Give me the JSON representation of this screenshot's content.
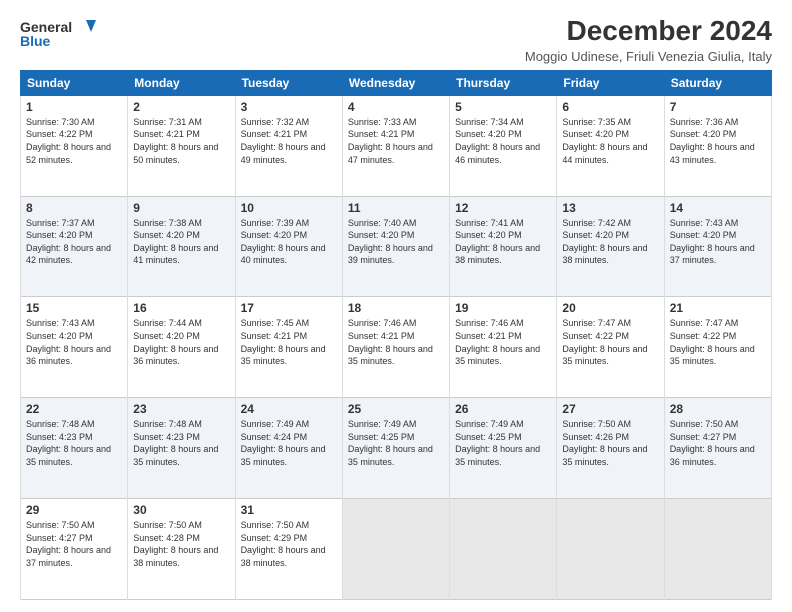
{
  "logo": {
    "line1": "General",
    "line2": "Blue"
  },
  "title": "December 2024",
  "location": "Moggio Udinese, Friuli Venezia Giulia, Italy",
  "days_header": [
    "Sunday",
    "Monday",
    "Tuesday",
    "Wednesday",
    "Thursday",
    "Friday",
    "Saturday"
  ],
  "weeks": [
    [
      {
        "day": "1",
        "sunrise": "Sunrise: 7:30 AM",
        "sunset": "Sunset: 4:22 PM",
        "daylight": "Daylight: 8 hours and 52 minutes."
      },
      {
        "day": "2",
        "sunrise": "Sunrise: 7:31 AM",
        "sunset": "Sunset: 4:21 PM",
        "daylight": "Daylight: 8 hours and 50 minutes."
      },
      {
        "day": "3",
        "sunrise": "Sunrise: 7:32 AM",
        "sunset": "Sunset: 4:21 PM",
        "daylight": "Daylight: 8 hours and 49 minutes."
      },
      {
        "day": "4",
        "sunrise": "Sunrise: 7:33 AM",
        "sunset": "Sunset: 4:21 PM",
        "daylight": "Daylight: 8 hours and 47 minutes."
      },
      {
        "day": "5",
        "sunrise": "Sunrise: 7:34 AM",
        "sunset": "Sunset: 4:20 PM",
        "daylight": "Daylight: 8 hours and 46 minutes."
      },
      {
        "day": "6",
        "sunrise": "Sunrise: 7:35 AM",
        "sunset": "Sunset: 4:20 PM",
        "daylight": "Daylight: 8 hours and 44 minutes."
      },
      {
        "day": "7",
        "sunrise": "Sunrise: 7:36 AM",
        "sunset": "Sunset: 4:20 PM",
        "daylight": "Daylight: 8 hours and 43 minutes."
      }
    ],
    [
      {
        "day": "8",
        "sunrise": "Sunrise: 7:37 AM",
        "sunset": "Sunset: 4:20 PM",
        "daylight": "Daylight: 8 hours and 42 minutes."
      },
      {
        "day": "9",
        "sunrise": "Sunrise: 7:38 AM",
        "sunset": "Sunset: 4:20 PM",
        "daylight": "Daylight: 8 hours and 41 minutes."
      },
      {
        "day": "10",
        "sunrise": "Sunrise: 7:39 AM",
        "sunset": "Sunset: 4:20 PM",
        "daylight": "Daylight: 8 hours and 40 minutes."
      },
      {
        "day": "11",
        "sunrise": "Sunrise: 7:40 AM",
        "sunset": "Sunset: 4:20 PM",
        "daylight": "Daylight: 8 hours and 39 minutes."
      },
      {
        "day": "12",
        "sunrise": "Sunrise: 7:41 AM",
        "sunset": "Sunset: 4:20 PM",
        "daylight": "Daylight: 8 hours and 38 minutes."
      },
      {
        "day": "13",
        "sunrise": "Sunrise: 7:42 AM",
        "sunset": "Sunset: 4:20 PM",
        "daylight": "Daylight: 8 hours and 38 minutes."
      },
      {
        "day": "14",
        "sunrise": "Sunrise: 7:43 AM",
        "sunset": "Sunset: 4:20 PM",
        "daylight": "Daylight: 8 hours and 37 minutes."
      }
    ],
    [
      {
        "day": "15",
        "sunrise": "Sunrise: 7:43 AM",
        "sunset": "Sunset: 4:20 PM",
        "daylight": "Daylight: 8 hours and 36 minutes."
      },
      {
        "day": "16",
        "sunrise": "Sunrise: 7:44 AM",
        "sunset": "Sunset: 4:20 PM",
        "daylight": "Daylight: 8 hours and 36 minutes."
      },
      {
        "day": "17",
        "sunrise": "Sunrise: 7:45 AM",
        "sunset": "Sunset: 4:21 PM",
        "daylight": "Daylight: 8 hours and 35 minutes."
      },
      {
        "day": "18",
        "sunrise": "Sunrise: 7:46 AM",
        "sunset": "Sunset: 4:21 PM",
        "daylight": "Daylight: 8 hours and 35 minutes."
      },
      {
        "day": "19",
        "sunrise": "Sunrise: 7:46 AM",
        "sunset": "Sunset: 4:21 PM",
        "daylight": "Daylight: 8 hours and 35 minutes."
      },
      {
        "day": "20",
        "sunrise": "Sunrise: 7:47 AM",
        "sunset": "Sunset: 4:22 PM",
        "daylight": "Daylight: 8 hours and 35 minutes."
      },
      {
        "day": "21",
        "sunrise": "Sunrise: 7:47 AM",
        "sunset": "Sunset: 4:22 PM",
        "daylight": "Daylight: 8 hours and 35 minutes."
      }
    ],
    [
      {
        "day": "22",
        "sunrise": "Sunrise: 7:48 AM",
        "sunset": "Sunset: 4:23 PM",
        "daylight": "Daylight: 8 hours and 35 minutes."
      },
      {
        "day": "23",
        "sunrise": "Sunrise: 7:48 AM",
        "sunset": "Sunset: 4:23 PM",
        "daylight": "Daylight: 8 hours and 35 minutes."
      },
      {
        "day": "24",
        "sunrise": "Sunrise: 7:49 AM",
        "sunset": "Sunset: 4:24 PM",
        "daylight": "Daylight: 8 hours and 35 minutes."
      },
      {
        "day": "25",
        "sunrise": "Sunrise: 7:49 AM",
        "sunset": "Sunset: 4:25 PM",
        "daylight": "Daylight: 8 hours and 35 minutes."
      },
      {
        "day": "26",
        "sunrise": "Sunrise: 7:49 AM",
        "sunset": "Sunset: 4:25 PM",
        "daylight": "Daylight: 8 hours and 35 minutes."
      },
      {
        "day": "27",
        "sunrise": "Sunrise: 7:50 AM",
        "sunset": "Sunset: 4:26 PM",
        "daylight": "Daylight: 8 hours and 35 minutes."
      },
      {
        "day": "28",
        "sunrise": "Sunrise: 7:50 AM",
        "sunset": "Sunset: 4:27 PM",
        "daylight": "Daylight: 8 hours and 36 minutes."
      }
    ],
    [
      {
        "day": "29",
        "sunrise": "Sunrise: 7:50 AM",
        "sunset": "Sunset: 4:27 PM",
        "daylight": "Daylight: 8 hours and 37 minutes."
      },
      {
        "day": "30",
        "sunrise": "Sunrise: 7:50 AM",
        "sunset": "Sunset: 4:28 PM",
        "daylight": "Daylight: 8 hours and 38 minutes."
      },
      {
        "day": "31",
        "sunrise": "Sunrise: 7:50 AM",
        "sunset": "Sunset: 4:29 PM",
        "daylight": "Daylight: 8 hours and 38 minutes."
      },
      null,
      null,
      null,
      null
    ]
  ]
}
